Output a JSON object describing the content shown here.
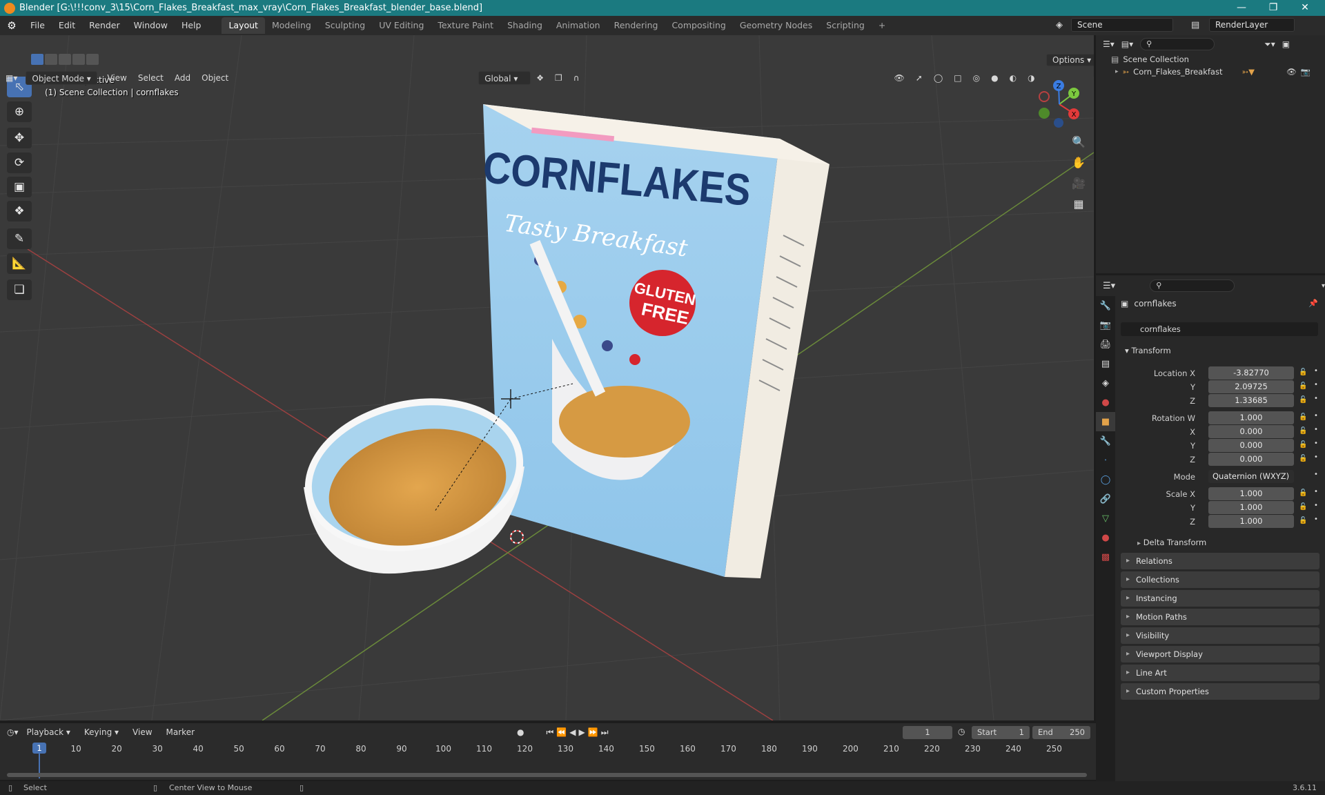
{
  "window": {
    "title": "Blender [G:\\!!!conv_3\\15\\Corn_Flakes_Breakfast_max_vray\\Corn_Flakes_Breakfast_blender_base.blend]"
  },
  "menu": {
    "items": [
      "File",
      "Edit",
      "Render",
      "Window",
      "Help"
    ]
  },
  "workspaces": [
    "Layout",
    "Modeling",
    "Sculpting",
    "UV Editing",
    "Texture Paint",
    "Shading",
    "Animation",
    "Rendering",
    "Compositing",
    "Geometry Nodes",
    "Scripting"
  ],
  "workspace_add": "+",
  "scene": {
    "name": "Scene",
    "view_layer": "RenderLayer"
  },
  "viewport": {
    "mode": "Object Mode",
    "menus": [
      "View",
      "Select",
      "Add",
      "Object"
    ],
    "orientation": "Global",
    "options_label": "Options",
    "overlay_line1": "User Perspective",
    "overlay_line2": "(1) Scene Collection | cornflakes",
    "gizmo_axes": [
      "X",
      "Y",
      "Z"
    ]
  },
  "box_art": {
    "title": "CORNFLAKES",
    "subtitle": "Tasty Breakfast",
    "badge_line1": "GLUTEN",
    "badge_line2": "FREE"
  },
  "outliner": {
    "root": "Scene Collection",
    "items": [
      {
        "label": "Corn_Flakes_Breakfast"
      }
    ]
  },
  "properties": {
    "object_name": "cornflakes",
    "datablock_name": "cornflakes",
    "transform_label": "Transform",
    "location": {
      "label_x": "Location X",
      "label_y": "Y",
      "label_z": "Z",
      "x": "-3.82770",
      "y": "2.09725",
      "z": "1.33685"
    },
    "rotation": {
      "label_w": "Rotation W",
      "label_x": "X",
      "label_y": "Y",
      "label_z": "Z",
      "w": "1.000",
      "x": "0.000",
      "y": "0.000",
      "z": "0.000"
    },
    "mode_label": "Mode",
    "mode_value": "Quaternion (WXYZ)",
    "scale": {
      "label_x": "Scale X",
      "label_y": "Y",
      "label_z": "Z",
      "x": "1.000",
      "y": "1.000",
      "z": "1.000"
    },
    "delta_transform": "Delta Transform",
    "panels": [
      "Relations",
      "Collections",
      "Instancing",
      "Motion Paths",
      "Visibility",
      "Viewport Display",
      "Line Art",
      "Custom Properties"
    ]
  },
  "timeline": {
    "menus": [
      "Playback",
      "Keying",
      "View",
      "Marker"
    ],
    "current_frame": "1",
    "start_label": "Start",
    "start": "1",
    "end_label": "End",
    "end": "250",
    "ticks": [
      "1",
      "10",
      "20",
      "30",
      "40",
      "50",
      "60",
      "70",
      "80",
      "90",
      "100",
      "110",
      "120",
      "130",
      "140",
      "150",
      "160",
      "170",
      "180",
      "190",
      "200",
      "210",
      "220",
      "230",
      "240",
      "250"
    ],
    "frame_range": [
      1,
      250
    ],
    "playhead": 1
  },
  "status": {
    "left": "Select",
    "middle": "Center View to Mouse",
    "version": "3.6.11"
  }
}
